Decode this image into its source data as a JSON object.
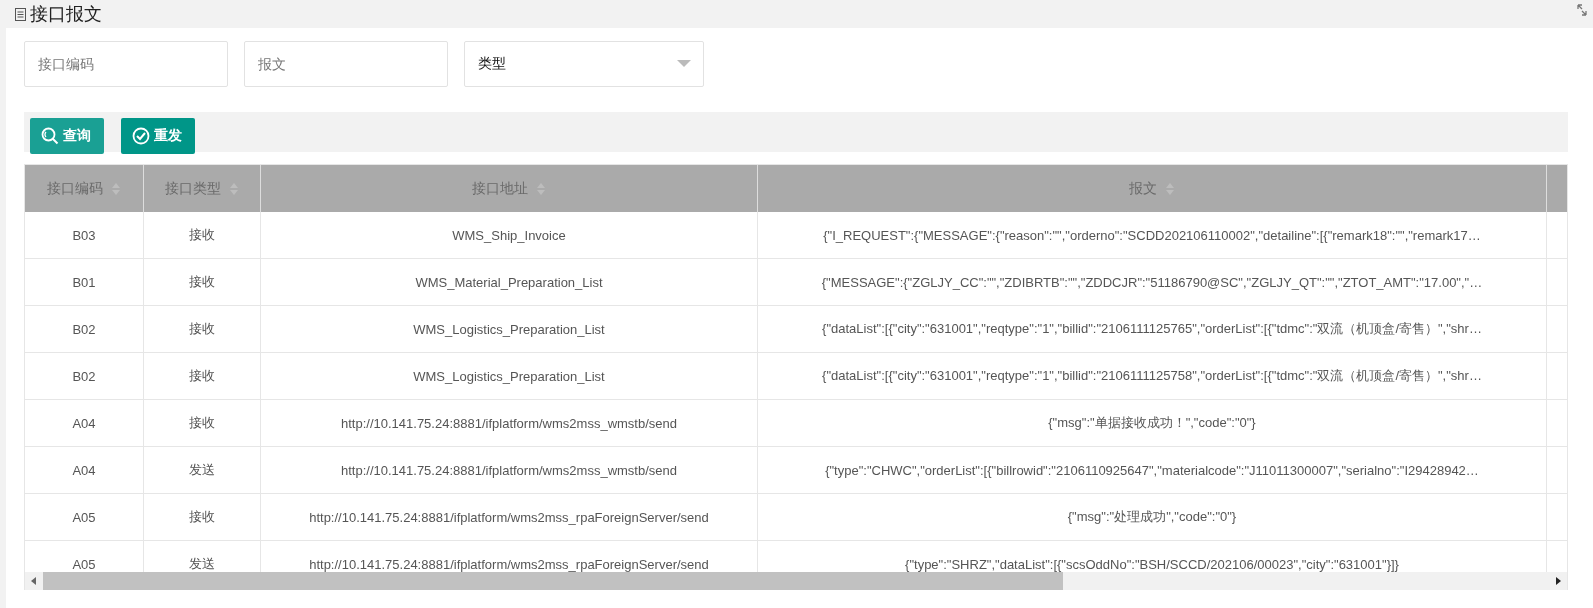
{
  "panel": {
    "title": "接口报文"
  },
  "filters": [
    {
      "kind": "input",
      "placeholder": "接口编码"
    },
    {
      "kind": "input",
      "placeholder": "报文"
    },
    {
      "kind": "select",
      "label": "类型"
    }
  ],
  "toolbar": [
    {
      "label": "查询"
    },
    {
      "label": "重发"
    }
  ],
  "table": {
    "columns": [
      {
        "label": "接口编码",
        "sortable": true
      },
      {
        "label": "接口类型",
        "sortable": true
      },
      {
        "label": "接口地址",
        "sortable": true
      },
      {
        "label": "报文",
        "sortable": true
      }
    ],
    "rows": [
      [
        "B03",
        "接收",
        "WMS_Ship_Invoice",
        "{\"I_REQUEST\":{\"MESSAGE\":{\"reason\":\"\",\"orderno\":\"SCDD202106110002\",\"detailine\":[{\"remark18\":\"\",\"remark17…"
      ],
      [
        "B01",
        "接收",
        "WMS_Material_Preparation_List",
        "{\"MESSAGE\":{\"ZGLJY_CC\":\"\",\"ZDIBRTB\":\"\",\"ZDDCJR\":\"51186790@SC\",\"ZGLJY_QT\":\"\",\"ZTOT_AMT\":\"17.00\",\"…"
      ],
      [
        "B02",
        "接收",
        "WMS_Logistics_Preparation_List",
        "{\"dataList\":[{\"city\":\"631001\",\"reqtype\":\"1\",\"billid\":\"2106111125765\",\"orderList\":[{\"tdmc\":\"双流（机顶盒/寄售）\",\"shr…"
      ],
      [
        "B02",
        "接收",
        "WMS_Logistics_Preparation_List",
        "{\"dataList\":[{\"city\":\"631001\",\"reqtype\":\"1\",\"billid\":\"2106111125758\",\"orderList\":[{\"tdmc\":\"双流（机顶盒/寄售）\",\"shr…"
      ],
      [
        "A04",
        "接收",
        "http://10.141.75.24:8881/ifplatform/wms2mss_wmstb/send",
        "{\"msg\":\"单据接收成功！\",\"code\":\"0\"}"
      ],
      [
        "A04",
        "发送",
        "http://10.141.75.24:8881/ifplatform/wms2mss_wmstb/send",
        "{\"type\":\"CHWC\",\"orderList\":[{\"billrowid\":\"2106110925647\",\"materialcode\":\"J11011300007\",\"serialno\":\"I29428942…"
      ],
      [
        "A05",
        "接收",
        "http://10.141.75.24:8881/ifplatform/wms2mss_rpaForeignServer/send",
        "{\"msg\":\"处理成功\",\"code\":\"0\"}"
      ],
      [
        "A05",
        "发送",
        "http://10.141.75.24:8881/ifplatform/wms2mss_rpaForeignServer/send",
        "{\"type\":\"SHRZ\",\"dataList\":[{\"scsOddNo\":\"BSH/SCCD/202106/00023\",\"city\":\"631001\"}]}"
      ]
    ]
  }
}
